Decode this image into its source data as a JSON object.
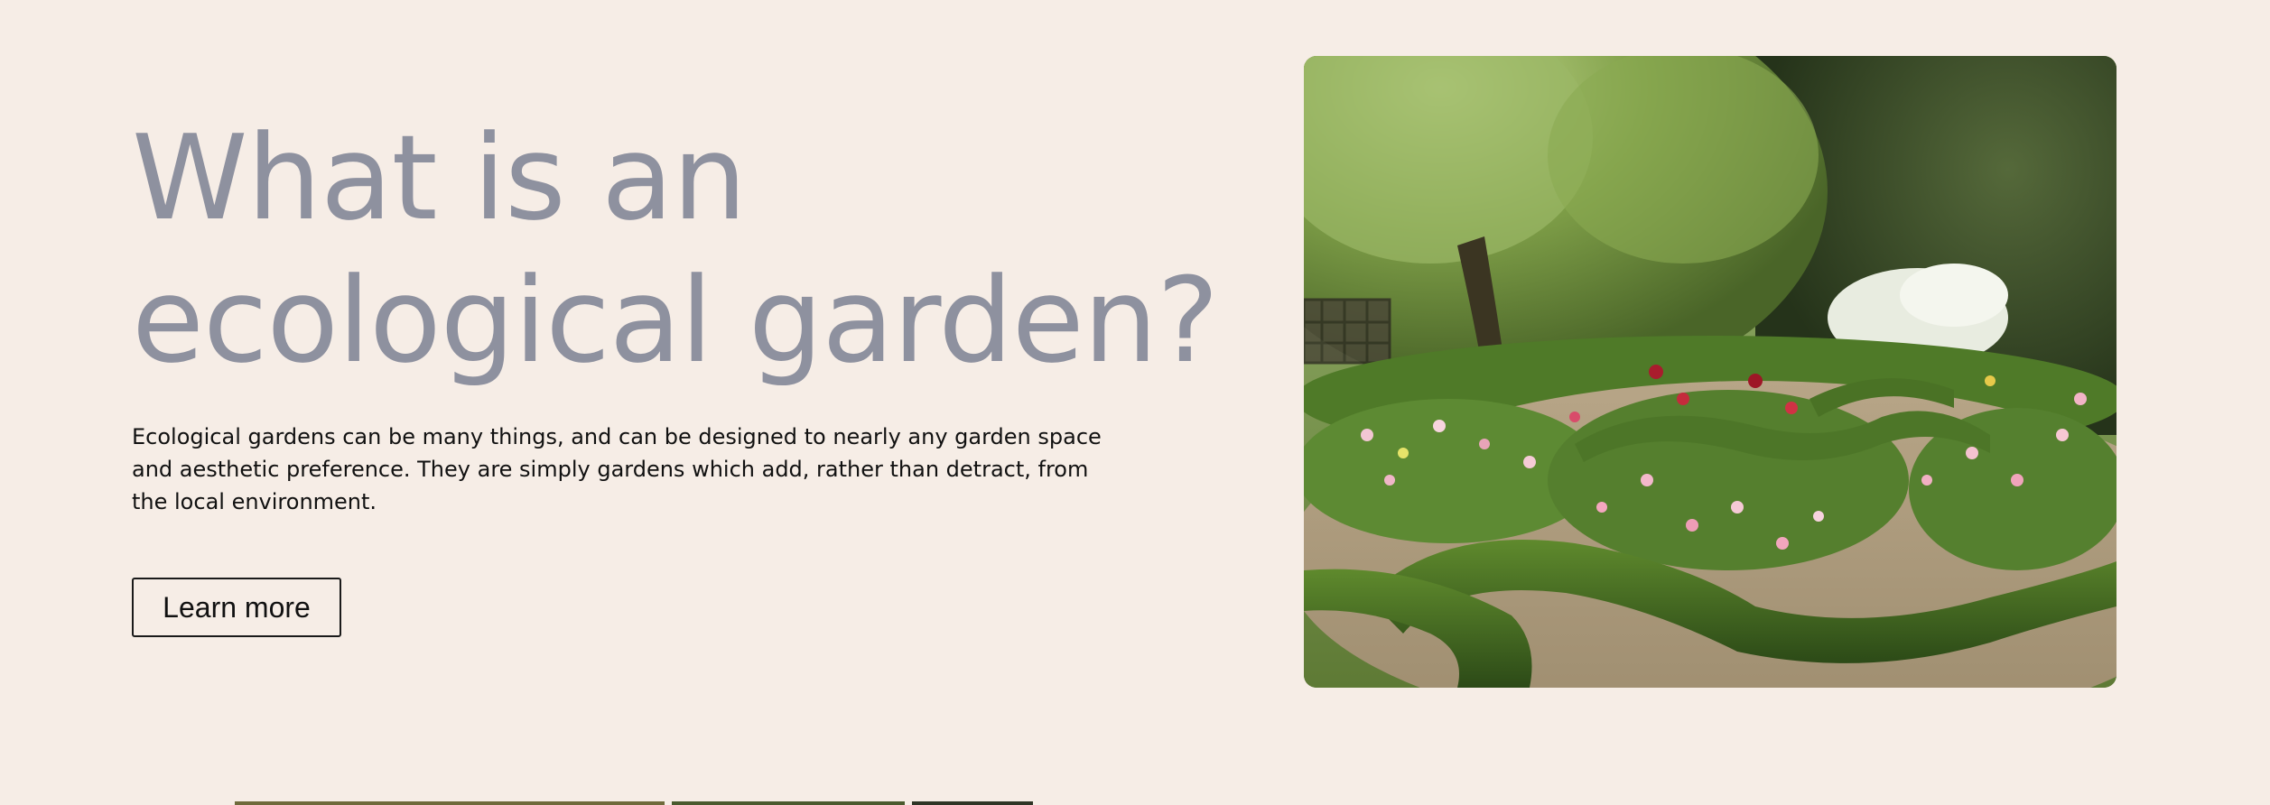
{
  "hero": {
    "title_line1": "What is an",
    "title_line2": "ecological garden?",
    "description": "Ecological gardens can be many things, and can be designed to nearly any garden space and aesthetic preference. They are simply gardens which add, rather than detract, from the local environment.",
    "button_label": "Learn more"
  },
  "colors": {
    "background": "#f6ede6",
    "title": "#8e919f",
    "text": "#111111"
  }
}
